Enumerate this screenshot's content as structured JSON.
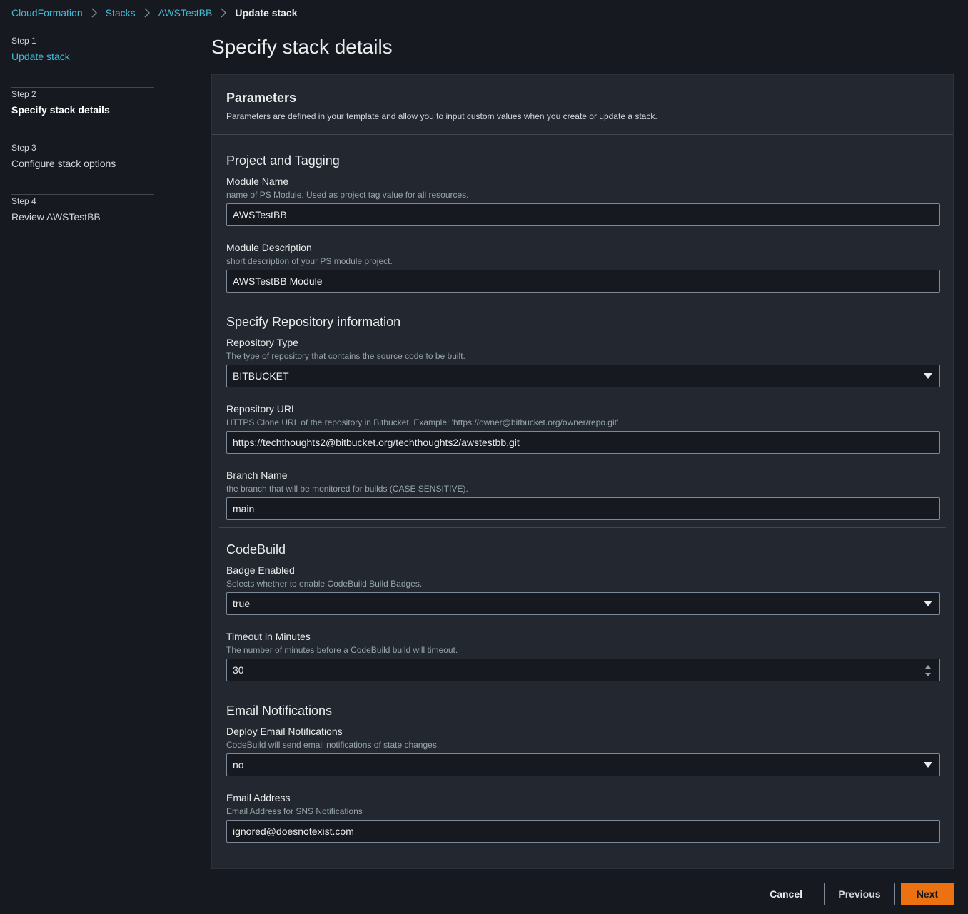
{
  "breadcrumb": {
    "items": [
      "CloudFormation",
      "Stacks",
      "AWSTestBB"
    ],
    "current": "Update stack"
  },
  "steps": [
    {
      "num": "Step 1",
      "title": "Update stack"
    },
    {
      "num": "Step 2",
      "title": "Specify stack details"
    },
    {
      "num": "Step 3",
      "title": "Configure stack options"
    },
    {
      "num": "Step 4",
      "title": "Review AWSTestBB"
    }
  ],
  "page_title": "Specify stack details",
  "parameters": {
    "title": "Parameters",
    "description": "Parameters are defined in your template and allow you to input custom values when you create or update a stack."
  },
  "sections": {
    "project": {
      "title": "Project and Tagging",
      "module_name": {
        "label": "Module Name",
        "desc": "name of PS Module. Used as project tag value for all resources.",
        "value": "AWSTestBB"
      },
      "module_description": {
        "label": "Module Description",
        "desc": "short description of your PS module project.",
        "value": "AWSTestBB Module"
      }
    },
    "repository": {
      "title": "Specify Repository information",
      "repo_type": {
        "label": "Repository Type",
        "desc": "The type of repository that contains the source code to be built.",
        "value": "BITBUCKET"
      },
      "repo_url": {
        "label": "Repository URL",
        "desc": "HTTPS Clone URL of the repository in Bitbucket. Example: 'https://owner@bitbucket.org/owner/repo.git'",
        "value": "https://techthoughts2@bitbucket.org/techthoughts2/awstestbb.git"
      },
      "branch_name": {
        "label": "Branch Name",
        "desc": "the branch that will be monitored for builds (CASE SENSITIVE).",
        "value": "main"
      }
    },
    "codebuild": {
      "title": "CodeBuild",
      "badge_enabled": {
        "label": "Badge Enabled",
        "desc": "Selects whether to enable CodeBuild Build Badges.",
        "value": "true"
      },
      "timeout": {
        "label": "Timeout in Minutes",
        "desc": "The number of minutes before a CodeBuild build will timeout.",
        "value": "30"
      }
    },
    "email": {
      "title": "Email Notifications",
      "deploy_email": {
        "label": "Deploy Email Notifications",
        "desc": "CodeBuild will send email notifications of state changes.",
        "value": "no"
      },
      "email_address": {
        "label": "Email Address",
        "desc": "Email Address for SNS Notifications",
        "value": "ignored@doesnotexist.com"
      }
    }
  },
  "footer": {
    "cancel": "Cancel",
    "previous": "Previous",
    "next": "Next"
  },
  "colors": {
    "accent_link": "#44b9d6",
    "primary_button": "#ec7211",
    "background": "#16191f",
    "panel": "#232830"
  }
}
